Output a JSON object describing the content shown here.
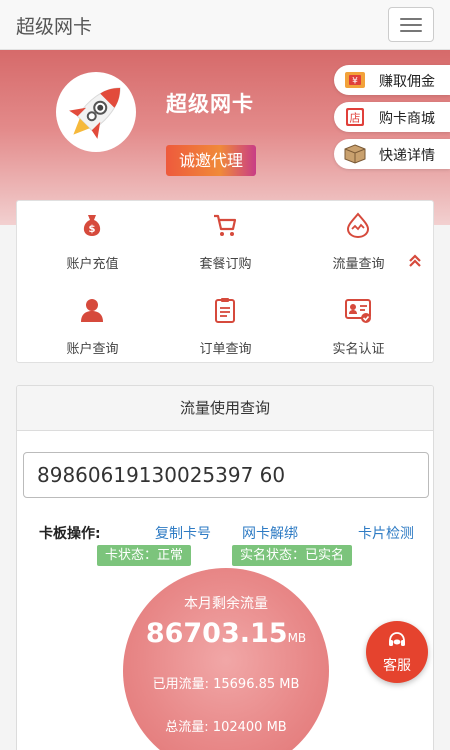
{
  "navbar": {
    "brand": "超级网卡",
    "menu_icon": "hamburger-icon"
  },
  "hero": {
    "title": "超级网卡",
    "invite_label": "诚邀代理",
    "side_buttons": [
      {
        "label": "赚取佣金",
        "icon": "money-icon"
      },
      {
        "label": "购卡商城",
        "icon": "store-icon"
      },
      {
        "label": "快递详情",
        "icon": "package-icon"
      }
    ]
  },
  "quick": {
    "items": [
      {
        "label": "账户充值",
        "icon": "money-bag-icon"
      },
      {
        "label": "套餐订购",
        "icon": "cart-icon"
      },
      {
        "label": "流量查询",
        "icon": "traffic-icon"
      },
      {
        "label": "账户查询",
        "icon": "user-icon"
      },
      {
        "label": "订单查询",
        "icon": "clipboard-icon"
      },
      {
        "label": "实名认证",
        "icon": "id-card-icon"
      }
    ],
    "collapse_icon": "double-chevron-up-icon"
  },
  "flow": {
    "header": "流量使用查询",
    "iccid": "89860619130025397 60",
    "ops_label": "卡板操作:",
    "links": [
      "复制卡号",
      "网卡解绑",
      "卡片检测"
    ],
    "card_status": "卡状态：正常",
    "realname_status": "实名状态：已实名",
    "remain_title": "本月剩余流量",
    "remain_value": "86703.15",
    "remain_unit": "MB",
    "used_text": "已用流量: 15696.85 MB",
    "total_text": "总流量: 102400 MB"
  },
  "service": {
    "label": "客服",
    "icon": "headset-icon"
  },
  "colors": {
    "accent": "#e5432e",
    "link": "#2e7bc4",
    "tag": "#7cc47c",
    "icon_red": "#d64a3c"
  }
}
